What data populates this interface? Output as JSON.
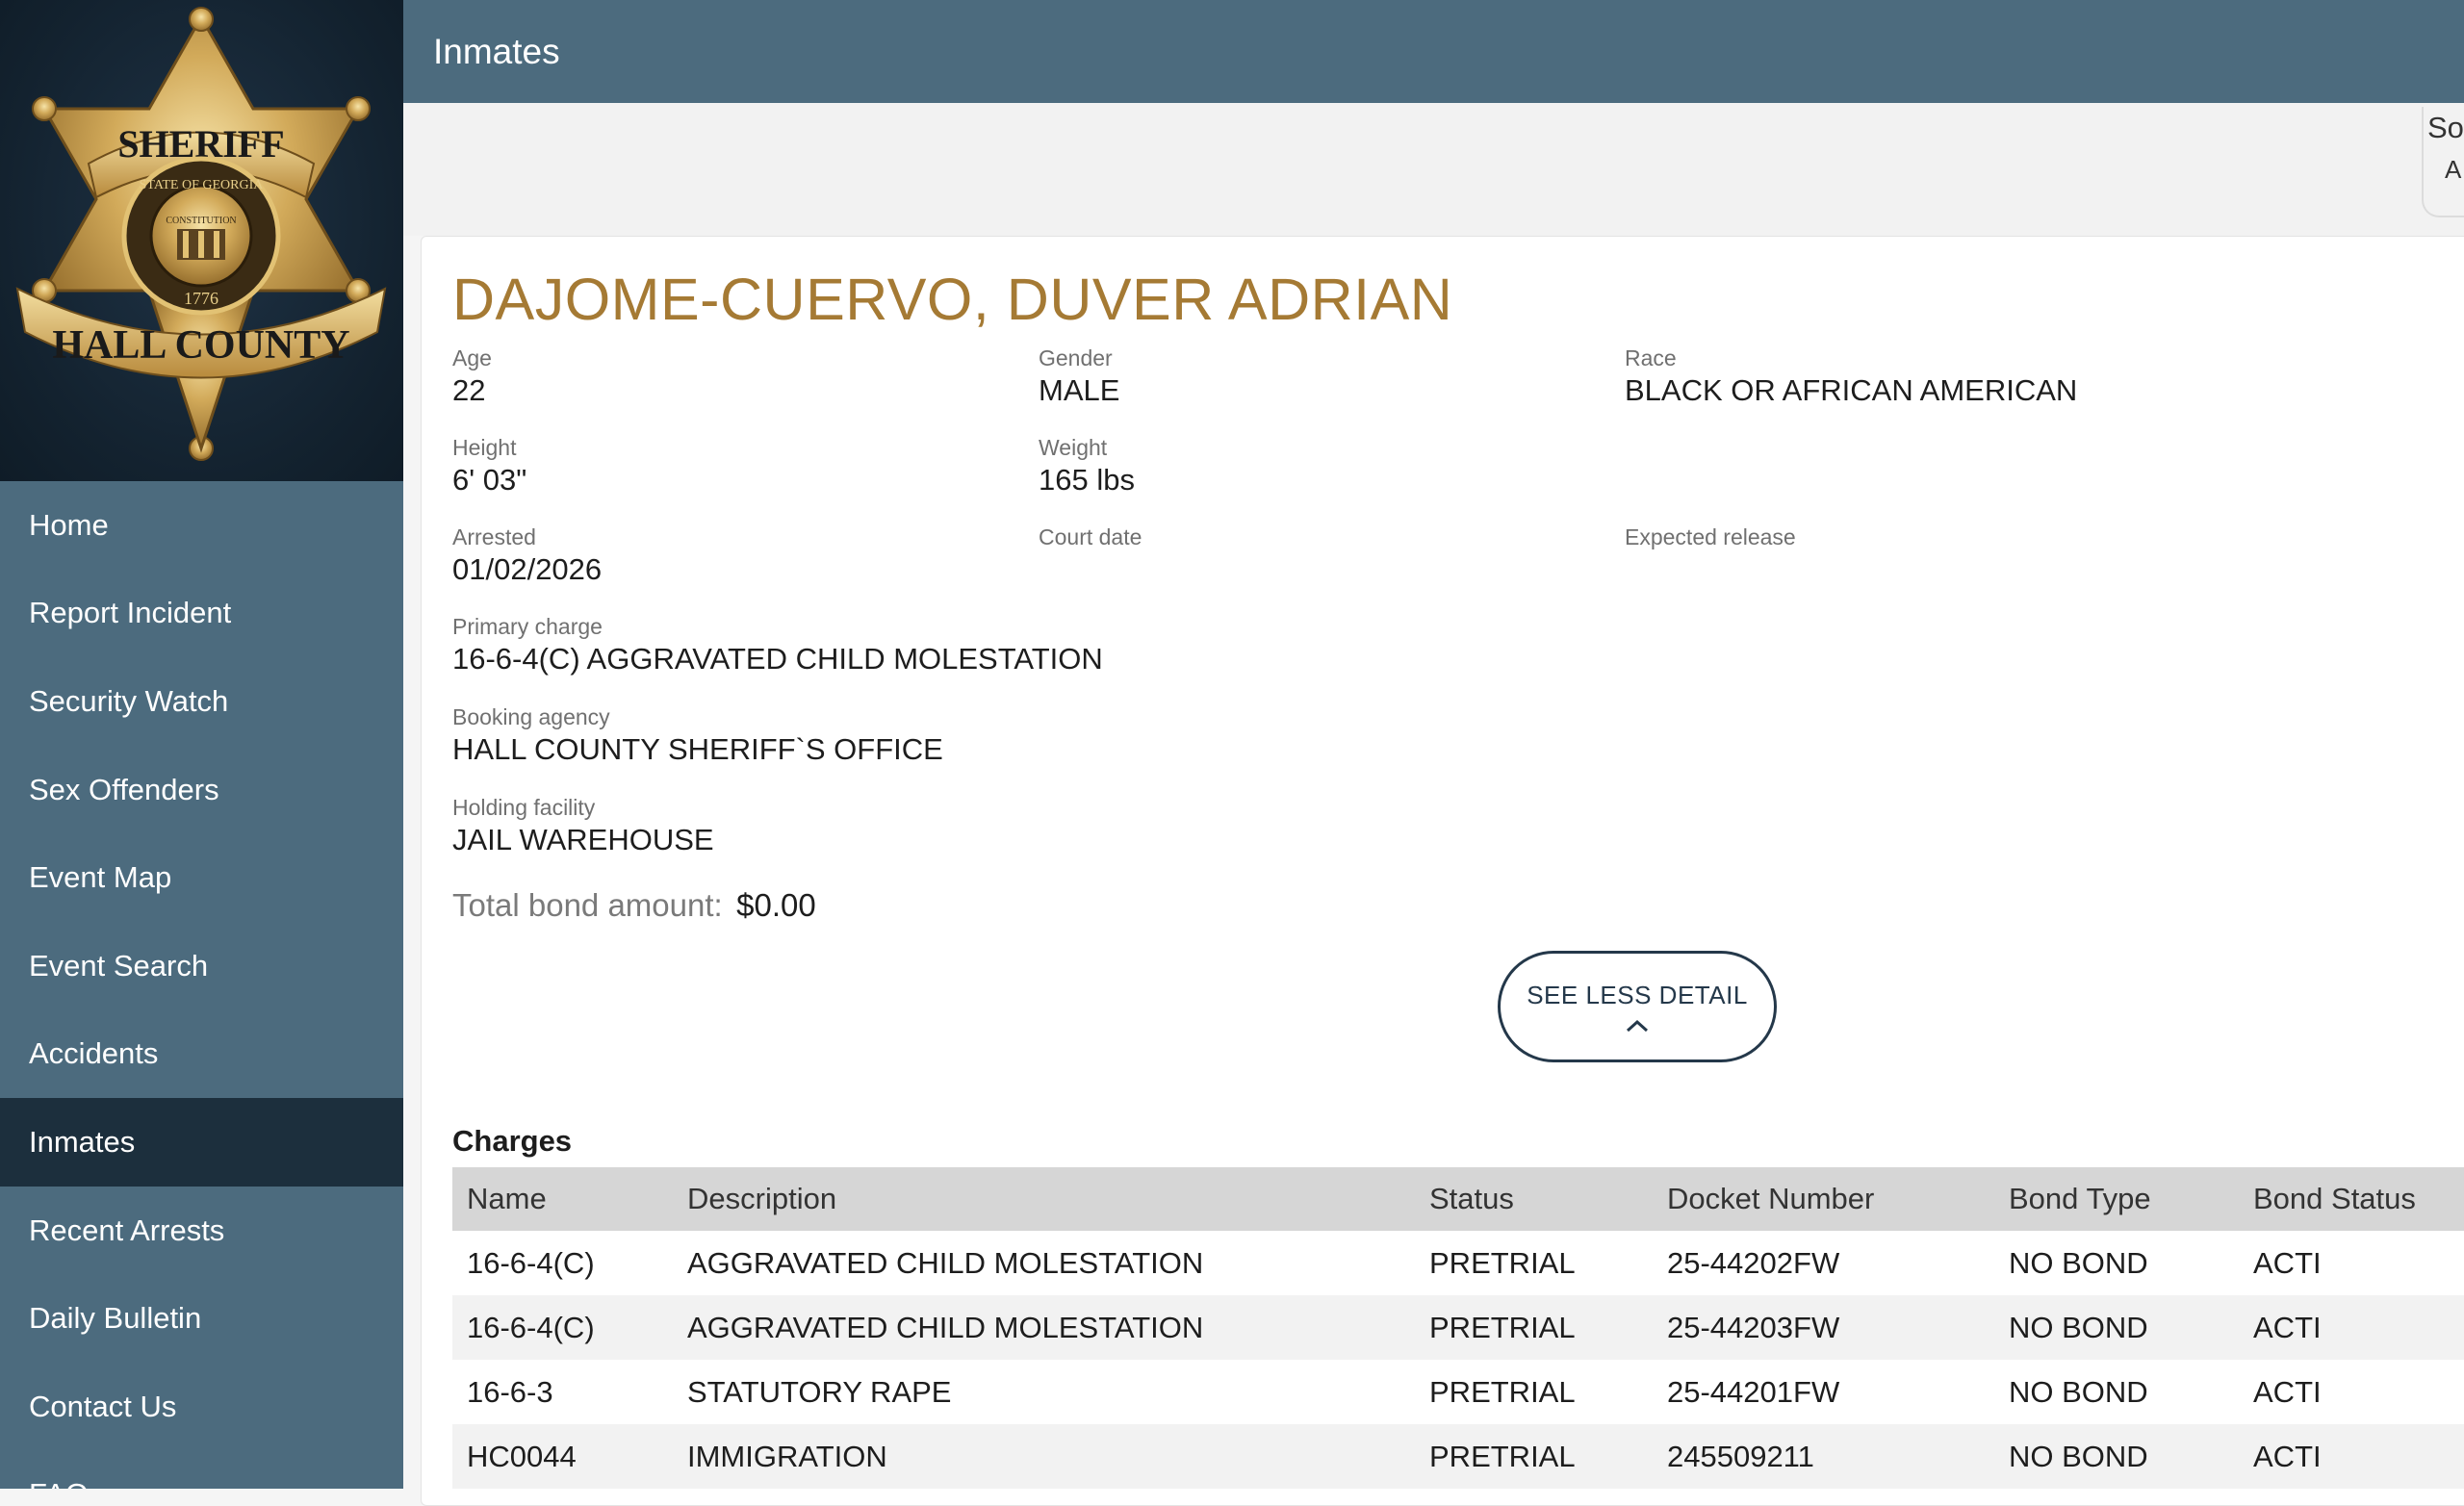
{
  "logo": {
    "top_text": "SHERIFF",
    "ring_text": "STATE OF GEORGIA",
    "inner_text": "CONSTITUTION",
    "year": "1776",
    "bottom_text": "HALL COUNTY"
  },
  "sidebar": {
    "items": [
      {
        "label": "Home",
        "active": false
      },
      {
        "label": "Report Incident",
        "active": false
      },
      {
        "label": "Security Watch",
        "active": false
      },
      {
        "label": "Sex Offenders",
        "active": false
      },
      {
        "label": "Event Map",
        "active": false
      },
      {
        "label": "Event Search",
        "active": false
      },
      {
        "label": "Accidents",
        "active": false
      },
      {
        "label": "Inmates",
        "active": true
      },
      {
        "label": "Recent Arrests",
        "active": false
      },
      {
        "label": "Daily Bulletin",
        "active": false
      },
      {
        "label": "Contact Us",
        "active": false
      },
      {
        "label": "FAQ",
        "active": false
      }
    ]
  },
  "header": {
    "title": "Inmates"
  },
  "sort": {
    "label": "So",
    "value": "A"
  },
  "inmate": {
    "name": "DAJOME-CUERVO, DUVER ADRIAN",
    "age_label": "Age",
    "age": "22",
    "gender_label": "Gender",
    "gender": "MALE",
    "race_label": "Race",
    "race": "BLACK OR AFRICAN AMERICAN",
    "height_label": "Height",
    "height": "6' 03\"",
    "weight_label": "Weight",
    "weight": "165 lbs",
    "arrested_label": "Arrested",
    "arrested": "01/02/2026",
    "court_date_label": "Court date",
    "court_date": "",
    "expected_release_label": "Expected release",
    "expected_release": "",
    "primary_charge_label": "Primary charge",
    "primary_charge": "16-6-4(C) AGGRAVATED CHILD MOLESTATION",
    "booking_agency_label": "Booking agency",
    "booking_agency": "HALL COUNTY SHERIFF`S OFFICE",
    "holding_facility_label": "Holding facility",
    "holding_facility": "JAIL WAREHOUSE",
    "bond_label": "Total bond amount:",
    "bond_amount": "$0.00"
  },
  "detail_toggle": {
    "label": "SEE LESS DETAIL",
    "icon": "chevron-up-icon"
  },
  "charges": {
    "title": "Charges",
    "columns": [
      "Name",
      "Description",
      "Status",
      "Docket Number",
      "Bond Type",
      "Bond Status"
    ],
    "rows": [
      [
        "16-6-4(C)",
        "AGGRAVATED CHILD MOLESTATION",
        "PRETRIAL",
        "25-44202FW",
        "NO BOND",
        "ACTI"
      ],
      [
        "16-6-4(C)",
        "AGGRAVATED CHILD MOLESTATION",
        "PRETRIAL",
        "25-44203FW",
        "NO BOND",
        "ACTI"
      ],
      [
        "16-6-3",
        "STATUTORY RAPE",
        "PRETRIAL",
        "25-44201FW",
        "NO BOND",
        "ACTI"
      ],
      [
        "HC0044",
        "IMMIGRATION",
        "PRETRIAL",
        "245509211",
        "NO BOND",
        "ACTI"
      ]
    ]
  },
  "colors": {
    "sidebar_bg": "#4c6b7e",
    "sidebar_active": "#1c2f3d",
    "name_gold": "#a57a34",
    "button_border": "#24384a"
  }
}
